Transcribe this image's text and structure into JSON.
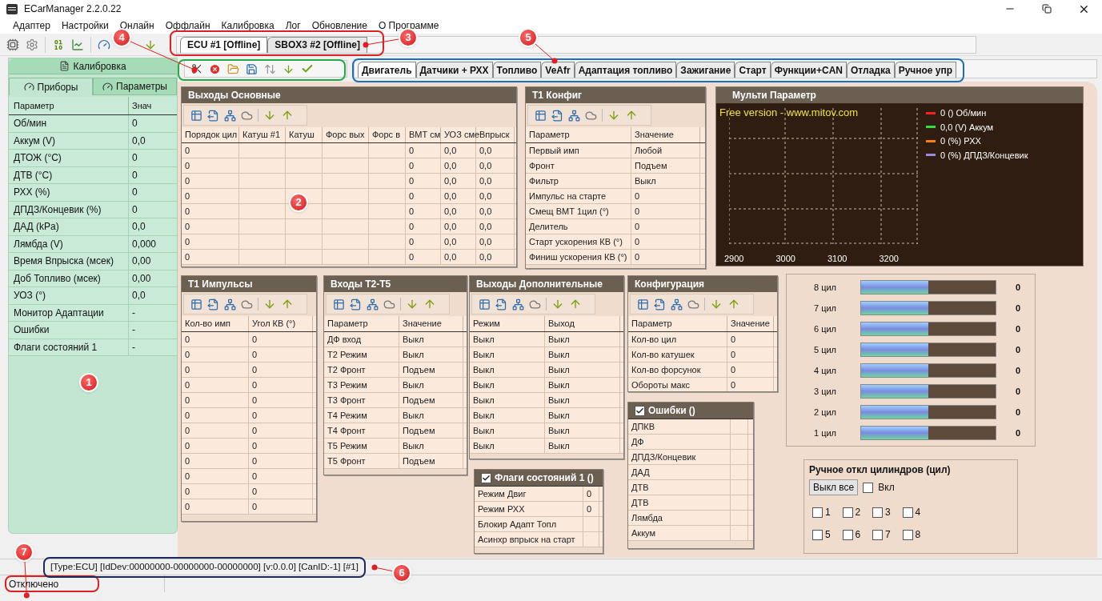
{
  "window": {
    "title": "ECarManager 2.2.0.22"
  },
  "menu": [
    "Адаптер",
    "Настройки",
    "Онлайн",
    "Оффлайн",
    "Калибровка",
    "Лог",
    "Обновление",
    "О Программе"
  ],
  "device_tabs": [
    {
      "label": "ECU #1 [Offline]",
      "selected": true
    },
    {
      "label": "SBOX3 #2 [Offline]",
      "selected": false
    }
  ],
  "left_panel": {
    "calibration_button": "Калибровка",
    "tabs": [
      {
        "label": "Приборы",
        "selected": true
      },
      {
        "label": "Параметры",
        "selected": false
      }
    ],
    "columns": [
      "Параметр",
      "Знач"
    ],
    "rows": [
      [
        "Об/мин",
        "0"
      ],
      [
        "Аккум (V)",
        "0,0"
      ],
      [
        "ДТОЖ (°С)",
        "0"
      ],
      [
        "ДТВ (°С)",
        "0"
      ],
      [
        "РХХ (%)",
        "0"
      ],
      [
        "ДПДЗ/Концевик (%)",
        "0"
      ],
      [
        "ДАД (kPa)",
        "0,0"
      ],
      [
        "Лямбда (V)",
        "0,000"
      ],
      [
        "Время Впрыска (мсек)",
        "0,00"
      ],
      [
        "Доб Топливо (мсек)",
        "0,00"
      ],
      [
        "УОЗ (°)",
        "0,0"
      ],
      [
        "Монитор Адаптации",
        "-"
      ],
      [
        "Ошибки",
        "-"
      ],
      [
        "Флаги состояний 1",
        "-"
      ]
    ]
  },
  "page_tabs": [
    {
      "label": "Двигатель",
      "selected": true
    },
    {
      "label": "Датчики + РХХ",
      "selected": false
    },
    {
      "label": "Топливо",
      "selected": false
    },
    {
      "label": "VeAfr",
      "selected": false
    },
    {
      "label": "Адаптация топливо",
      "selected": false
    },
    {
      "label": "Зажигание",
      "selected": false
    },
    {
      "label": "Старт",
      "selected": false
    },
    {
      "label": "Функции+CAN",
      "selected": false
    },
    {
      "label": "Отладка",
      "selected": false
    },
    {
      "label": "Ручное упр",
      "selected": false
    }
  ],
  "outputs_main": {
    "title": "Выходы Основные",
    "columns": [
      "Порядок цил",
      "Катуш #1",
      "Катуш",
      "Форс вых",
      "Форс в",
      "ВМТ см",
      "УОЗ сме",
      "Впрыск"
    ],
    "rows": [
      [
        "0",
        "",
        "",
        "",
        "",
        "0",
        "0,0",
        "0,0"
      ],
      [
        "0",
        "",
        "",
        "",
        "",
        "0",
        "0,0",
        "0,0"
      ],
      [
        "0",
        "",
        "",
        "",
        "",
        "0",
        "0,0",
        "0,0"
      ],
      [
        "0",
        "",
        "",
        "",
        "",
        "0",
        "0,0",
        "0,0"
      ],
      [
        "0",
        "",
        "",
        "",
        "",
        "0",
        "0,0",
        "0,0"
      ],
      [
        "0",
        "",
        "",
        "",
        "",
        "0",
        "0,0",
        "0,0"
      ],
      [
        "0",
        "",
        "",
        "",
        "",
        "0",
        "0,0",
        "0,0"
      ],
      [
        "0",
        "",
        "",
        "",
        "",
        "0",
        "0,0",
        "0,0"
      ]
    ]
  },
  "t1_config": {
    "title": "Т1 Конфиг",
    "columns": [
      "Параметр",
      "Значение"
    ],
    "rows": [
      [
        "Первый имп",
        "Любой"
      ],
      [
        "Фронт",
        "Подъем"
      ],
      [
        "Фильтр",
        "Выкл"
      ],
      [
        "Импульс на старте",
        "0"
      ],
      [
        "Смещ ВМТ 1цил (°)",
        "0"
      ],
      [
        "Делитель",
        "0"
      ],
      [
        "Старт ускорения КВ (°)",
        "0"
      ],
      [
        "Финиш ускорения КВ (°)",
        "0"
      ]
    ]
  },
  "multi_param": {
    "title": "Мульти Параметр",
    "banner": "Free version - www.mitov.com",
    "legend": [
      {
        "label": "0 () Об/мин",
        "color": "#ff2020"
      },
      {
        "label": "0,0 (V) Аккум",
        "color": "#30e040"
      },
      {
        "label": "0 (%) РХХ",
        "color": "#ff8000"
      },
      {
        "label": "0 (%) ДПДЗ/Концевик",
        "color": "#9b8ce0"
      }
    ],
    "x_labels": [
      "2900",
      "3000",
      "3100",
      "3200"
    ]
  },
  "t1_pulses": {
    "title": "Т1 Импульсы",
    "columns": [
      "Кол-во имп",
      "Угол КВ (°)"
    ],
    "rows": [
      [
        "0",
        "0"
      ],
      [
        "0",
        "0"
      ],
      [
        "0",
        "0"
      ],
      [
        "0",
        "0"
      ],
      [
        "0",
        "0"
      ],
      [
        "0",
        "0"
      ],
      [
        "0",
        "0"
      ],
      [
        "0",
        "0"
      ],
      [
        "0",
        "0"
      ],
      [
        "0",
        "0"
      ],
      [
        "0",
        "0"
      ],
      [
        "0",
        "0"
      ]
    ]
  },
  "inputs_t2_t5": {
    "title": "Входы Т2-Т5",
    "columns": [
      "Параметр",
      "Значение"
    ],
    "rows": [
      [
        "ДФ вход",
        "Выкл"
      ],
      [
        "Т2 Режим",
        "Выкл"
      ],
      [
        "Т2 Фронт",
        "Подъем"
      ],
      [
        "Т3 Режим",
        "Выкл"
      ],
      [
        "Т3 Фронт",
        "Подъем"
      ],
      [
        "Т4 Режим",
        "Выкл"
      ],
      [
        "Т4 Фронт",
        "Подъем"
      ],
      [
        "Т5 Режим",
        "Выкл"
      ],
      [
        "Т5 Фронт",
        "Подъем"
      ]
    ]
  },
  "outputs_extra": {
    "title": "Выходы Дополнительные",
    "columns": [
      "Режим",
      "Выход"
    ],
    "rows": [
      [
        "Выкл",
        "Выкл"
      ],
      [
        "Выкл",
        "Выкл"
      ],
      [
        "Выкл",
        "Выкл"
      ],
      [
        "Выкл",
        "Выкл"
      ],
      [
        "Выкл",
        "Выкл"
      ],
      [
        "Выкл",
        "Выкл"
      ],
      [
        "Выкл",
        "Выкл"
      ],
      [
        "Выкл",
        "Выкл"
      ]
    ]
  },
  "configuration": {
    "title": "Конфигурация",
    "columns": [
      "Параметр",
      "Значение"
    ],
    "rows": [
      [
        "Кол-во цил",
        "0"
      ],
      [
        "Кол-во катушек",
        "0"
      ],
      [
        "Кол-во форсунок",
        "0"
      ],
      [
        "Обороты макс",
        "0"
      ]
    ]
  },
  "errors": {
    "title": "Ошибки ()",
    "checked": true,
    "rows": [
      [
        "ДПКВ",
        ""
      ],
      [
        "ДФ",
        ""
      ],
      [
        "ДПДЗ/Концевик",
        ""
      ],
      [
        "ДАД",
        ""
      ],
      [
        "ДТВ",
        ""
      ],
      [
        "ДТВ",
        ""
      ],
      [
        "Лямбда",
        ""
      ],
      [
        "Аккум",
        ""
      ]
    ]
  },
  "flags": {
    "title": "Флаги состояний 1 ()",
    "checked": true,
    "rows": [
      [
        "Режим Двиг",
        "0"
      ],
      [
        "Режим РХХ",
        "0"
      ],
      [
        "Блокир Адапт Топл",
        ""
      ],
      [
        "Асинхр впрыск на старт",
        ""
      ]
    ]
  },
  "cylinders": [
    {
      "label": "8 цил",
      "level": 0.5,
      "value": "0"
    },
    {
      "label": "7 цил",
      "level": 0.5,
      "value": "0"
    },
    {
      "label": "6 цил",
      "level": 0.5,
      "value": "0"
    },
    {
      "label": "5 цил",
      "level": 0.5,
      "value": "0"
    },
    {
      "label": "4 цил",
      "level": 0.5,
      "value": "0"
    },
    {
      "label": "3 цил",
      "level": 0.5,
      "value": "0"
    },
    {
      "label": "2 цил",
      "level": 0.5,
      "value": "0"
    },
    {
      "label": "1 цил",
      "level": 0.5,
      "value": "0"
    }
  ],
  "manual_off": {
    "title": "Ручное откл цилиндров (цил)",
    "button": "Выкл все",
    "enable": {
      "label": "Вкл",
      "checked": false
    },
    "cylinders": [
      {
        "label": "1",
        "checked": false
      },
      {
        "label": "2",
        "checked": false
      },
      {
        "label": "3",
        "checked": false
      },
      {
        "label": "4",
        "checked": false
      },
      {
        "label": "5",
        "checked": false
      },
      {
        "label": "6",
        "checked": false
      },
      {
        "label": "7",
        "checked": false
      },
      {
        "label": "8",
        "checked": false
      }
    ]
  },
  "status": {
    "device_info": "[Type:ECU] [IdDev:00000000-00000000-00000000] [v:0.0.0] [CanID:-1] [#1]",
    "connection": "Отключено"
  },
  "annotations": [
    {
      "number": "4"
    },
    {
      "number": "3"
    },
    {
      "number": "5"
    },
    {
      "number": "2"
    },
    {
      "number": "1"
    },
    {
      "number": "7"
    },
    {
      "number": "6"
    }
  ]
}
